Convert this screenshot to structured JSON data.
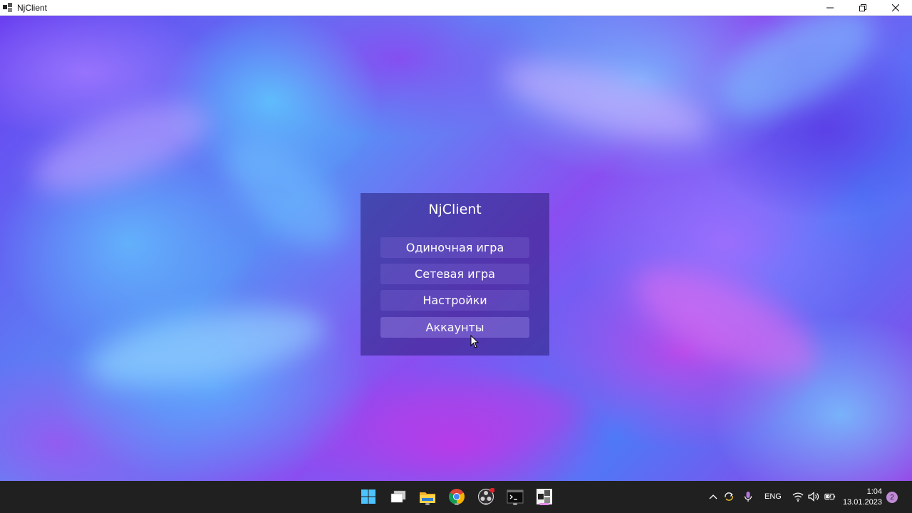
{
  "window": {
    "title": "NjClient"
  },
  "menu": {
    "title": "NjClient",
    "buttons": [
      {
        "label": "Одиночная игра"
      },
      {
        "label": "Сетевая игра"
      },
      {
        "label": "Настройки"
      },
      {
        "label": "Аккаунты"
      }
    ]
  },
  "taskbar": {
    "apps": [
      {
        "icon": "windows-start-icon"
      },
      {
        "icon": "task-view-icon"
      },
      {
        "icon": "file-explorer-icon"
      },
      {
        "icon": "chrome-icon"
      },
      {
        "icon": "obs-icon"
      },
      {
        "icon": "terminal-icon"
      },
      {
        "icon": "njclient-icon"
      }
    ],
    "tray": {
      "language": "ENG",
      "time": "1:04",
      "date": "13.01.2023",
      "notification_count": "2"
    }
  },
  "colors": {
    "taskbar_bg": "#202020",
    "panel_bg": "rgba(40,30,120,0.55)",
    "active_indicator": "#e48ae8"
  }
}
